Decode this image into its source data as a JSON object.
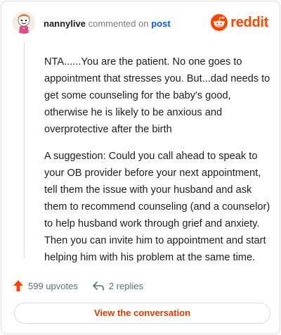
{
  "header": {
    "username": "nannylive",
    "commented_on": "commented on",
    "post_link": "post",
    "brand": "reddit"
  },
  "comment": {
    "paragraphs": [
      "NTA......You are the patient. No one goes to appointment that stresses you. But...dad needs to get some counseling for the baby's good, otherwise he is likely to be anxious and overprotective after the birth",
      "A suggestion: Could you call ahead to speak to your OB provider before your next appointment, tell them the issue with your husband and ask them to recommend counseling (and a counselor) to help husband work through grief and anxiety. Then you can invite him to appointment and start helping him with his problem at the same time."
    ]
  },
  "actions": {
    "upvotes": "599 upvotes",
    "replies": "2 replies",
    "view_button": "View the conversation"
  },
  "colors": {
    "brand": "#ff4500",
    "upvote": "#ff4500",
    "link": "#0a5bd6",
    "button_text": "#d93a00"
  },
  "icons": {
    "avatar": "snoo-avatar",
    "logo": "reddit-snoo-icon",
    "upvote": "upvote-arrow-icon",
    "reply": "reply-arrow-icon"
  }
}
